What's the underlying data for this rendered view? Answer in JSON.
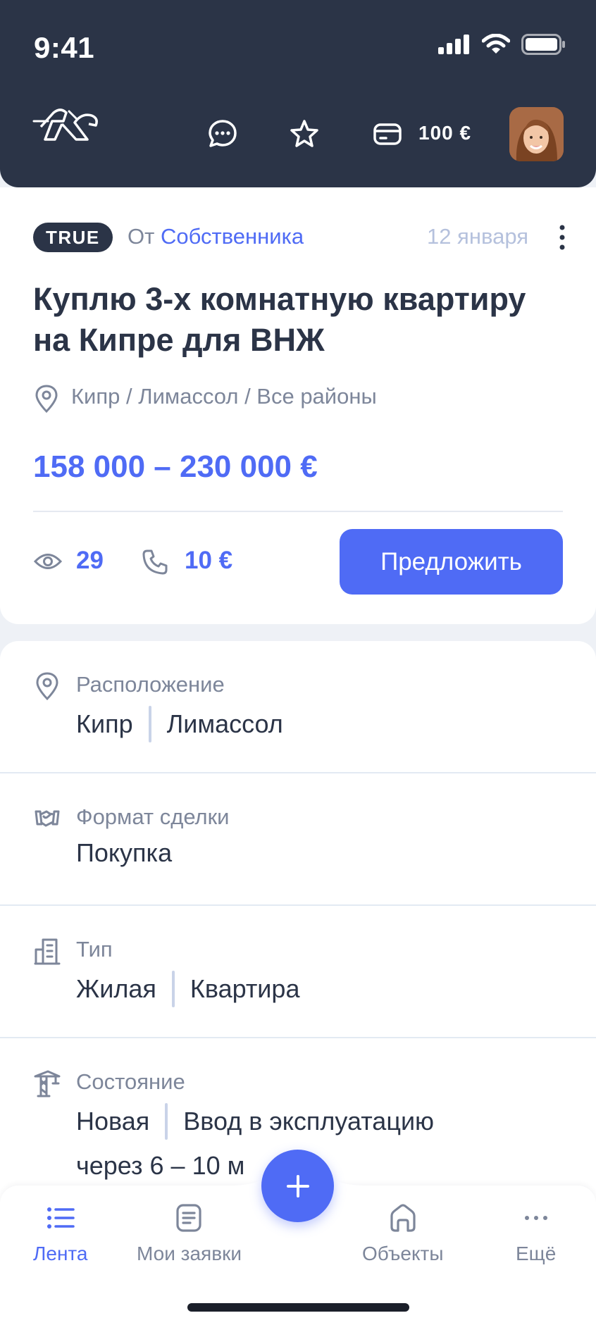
{
  "status_bar": {
    "time": "9:41"
  },
  "header": {
    "balance": "100 €"
  },
  "listing": {
    "badge": "TRUE",
    "from_prefix": "От",
    "from_who": "Собственника",
    "date": "12 января",
    "title": "Куплю 3-х комнатную квартиру на Кипре для ВНЖ",
    "address": "Кипр / Лимассол / Все районы",
    "price": "158 000 – 230 000 €",
    "views": "29",
    "call_price": "10 €",
    "offer_button": "Предложить"
  },
  "details": {
    "location": {
      "label": "Расположение",
      "values": [
        "Кипр",
        "Лимассол"
      ]
    },
    "deal_format": {
      "label": "Формат сделки",
      "values": [
        "Покупка"
      ]
    },
    "type": {
      "label": "Тип",
      "values": [
        "Жилая",
        "Квартира"
      ]
    },
    "condition": {
      "label": "Состояние",
      "values": [
        "Новая",
        "Ввод в эксплуатацию"
      ],
      "extra": "через 6 – 10 м"
    }
  },
  "bottom_nav": {
    "items": [
      {
        "label": "Лента",
        "icon": "list-icon",
        "active": true
      },
      {
        "label": "Мои заявки",
        "icon": "document-icon",
        "active": false
      },
      {
        "label": "Объекты",
        "icon": "home-icon",
        "active": false
      },
      {
        "label": "Ещё",
        "icon": "more-icon",
        "active": false
      }
    ]
  },
  "colors": {
    "header_bg": "#2b3447",
    "accent": "#4f6bf5",
    "muted": "#7d869a"
  }
}
